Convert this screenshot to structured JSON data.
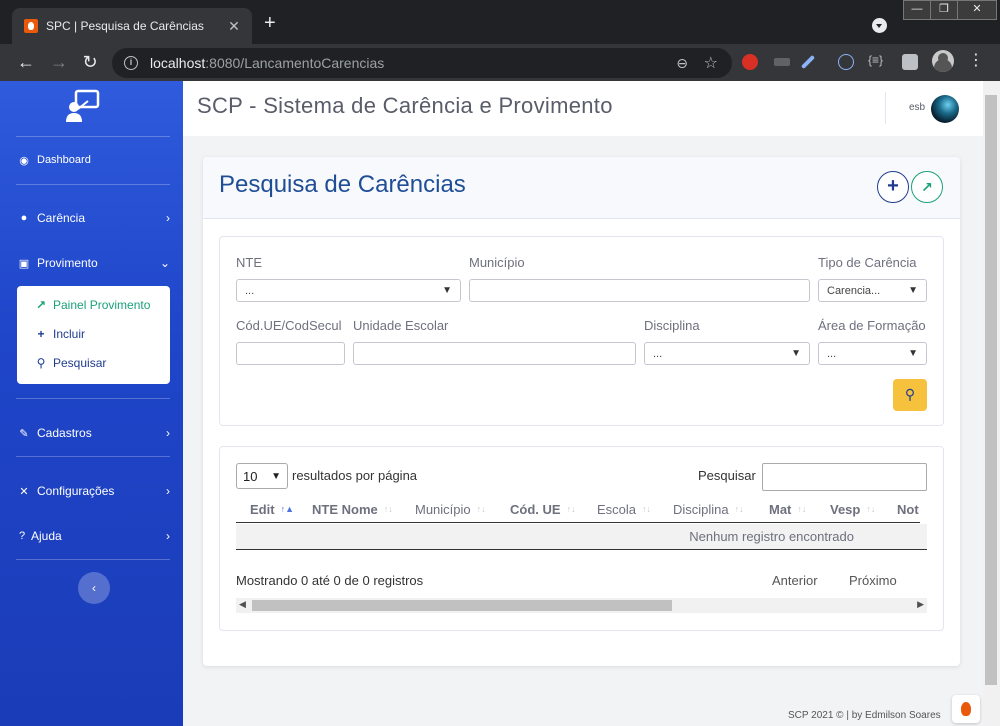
{
  "browser": {
    "tab_title": "SPC | Pesquisa de Carências",
    "tab_close": "✕",
    "new_tab": "+",
    "url_host": "localhost",
    "url_path": ":8080/LancamentoCarencias",
    "window_controls": [
      "—",
      "❐",
      "✕"
    ],
    "extension_labels": [
      "{≡}"
    ]
  },
  "sidebar": {
    "dashboard": "Dashboard",
    "items": [
      {
        "label": "Carência",
        "icon": "briefcase-icon"
      },
      {
        "label": "Provimento",
        "icon": "user-tie-icon"
      },
      {
        "label": "Cadastros",
        "icon": "edit-icon"
      },
      {
        "label": "Configurações",
        "icon": "tools-icon"
      },
      {
        "label": "Ajuda",
        "icon": "question-icon"
      }
    ],
    "submenu": [
      {
        "label": "Painel Provimento",
        "icon": "chart-line-icon"
      },
      {
        "label": "Incluir",
        "icon": "plus-icon"
      },
      {
        "label": "Pesquisar",
        "icon": "search-icon"
      }
    ],
    "collapse": "‹"
  },
  "topbar": {
    "title": "SCP - Sistema de Carência e Provimento",
    "user": "esb"
  },
  "page": {
    "title": "Pesquisa de Carências"
  },
  "filters": {
    "nte_label": "NTE",
    "nte_value": "...",
    "municipio_label": "Município",
    "municipio_value": "",
    "tipo_label": "Tipo de Carência",
    "tipo_value": "Carencia...",
    "codue_label": "Cód.UE/CodSecul",
    "codue_value": "",
    "unidade_label": "Unidade Escolar",
    "unidade_value": "",
    "disciplina_label": "Disciplina",
    "disciplina_value": "...",
    "area_label": "Área de Formação",
    "area_value": "..."
  },
  "table": {
    "page_length": "10",
    "length_label": "resultados por página",
    "search_label": "Pesquisar",
    "columns": [
      "Edit",
      "NTE Nome",
      "Município",
      "Cód. UE",
      "Escola",
      "Disciplina",
      "Mat",
      "Vesp",
      "Not"
    ],
    "empty": "Nenhum registro encontrado",
    "info": "Mostrando 0 até 0 de 0 registros",
    "prev": "Anterior",
    "next": "Próximo"
  },
  "footer": {
    "text": "SCP 2021  ©  |  by Edmilson Soares"
  },
  "colors": {
    "sidebar": "#1f45c9",
    "title": "#1f4e96",
    "accent_green": "#1aa179",
    "warning": "#f6c23e"
  }
}
